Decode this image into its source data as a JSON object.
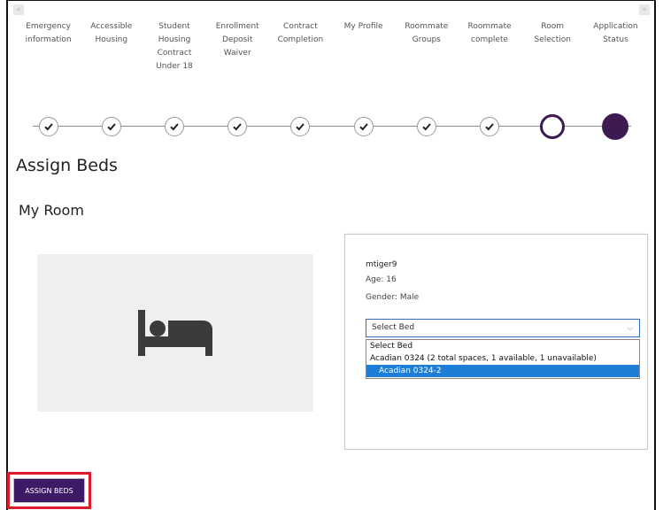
{
  "steps": [
    {
      "label": "Emergency information",
      "status": "complete"
    },
    {
      "label": "Accessible Housing",
      "status": "complete"
    },
    {
      "label": "Student Housing Contract Under 18",
      "status": "complete"
    },
    {
      "label": "Enrollment Deposit Waiver",
      "status": "complete"
    },
    {
      "label": "Contract Completion",
      "status": "complete"
    },
    {
      "label": "My Profile",
      "status": "complete"
    },
    {
      "label": "Roommate Groups",
      "status": "complete"
    },
    {
      "label": "Roommate complete",
      "status": "complete"
    },
    {
      "label": "Room Selection",
      "status": "current"
    },
    {
      "label": "Application Status",
      "status": "upcoming"
    }
  ],
  "icons": {
    "scroll_left": "chevron-left-icon",
    "scroll_right": "chevron-right-icon",
    "step_complete": "check-icon",
    "room": "bed-icon",
    "dropdown": "chevron-down-icon"
  },
  "page": {
    "title": "Assign Beds",
    "section_title": "My Room"
  },
  "occupant": {
    "username": "mtiger9",
    "age": "Age: 16",
    "gender": "Gender: Male"
  },
  "bed_select": {
    "value": "Select Bed",
    "options": [
      {
        "label": "Select Bed",
        "kind": "placeholder"
      },
      {
        "label": "Acadian 0324 (2 total spaces, 1 available, 1 unavailable)",
        "kind": "group"
      },
      {
        "label": "Acadian 0324-2",
        "kind": "option",
        "highlighted": true
      }
    ]
  },
  "actions": {
    "assign_label": "ASSIGN BEDS"
  },
  "colors": {
    "brand_purple": "#3d1a52",
    "button_purple": "#3d1a66",
    "highlight_blue": "#1e7ed6",
    "annotation_red": "#e11a2b"
  }
}
